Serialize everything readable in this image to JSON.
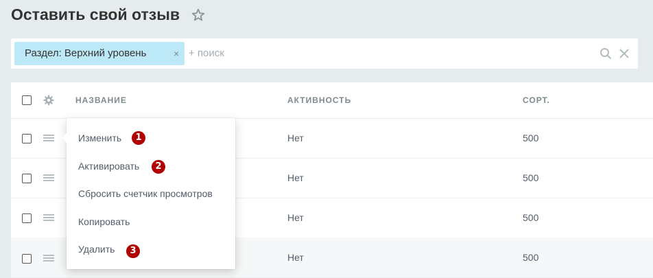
{
  "page": {
    "title": "Оставить свой отзыв"
  },
  "filter": {
    "chip_label": "Раздел: Верхний уровень",
    "chip_close": "×",
    "search_placeholder": "+ поиск"
  },
  "grid": {
    "columns": [
      "НАЗВАНИЕ",
      "АКТИВНОСТЬ",
      "СОРТ."
    ],
    "rows": [
      {
        "active": "Нет",
        "sort": "500"
      },
      {
        "active": "Нет",
        "sort": "500"
      },
      {
        "active": "Нет",
        "sort": "500"
      },
      {
        "active": "Нет",
        "sort": "500"
      }
    ]
  },
  "context_menu": {
    "items": [
      {
        "label": "Изменить",
        "badge": "1"
      },
      {
        "label": "Активировать",
        "badge": "2"
      },
      {
        "label": "Сбросить счетчик просмотров"
      },
      {
        "label": "Копировать"
      },
      {
        "label": "Удалить",
        "badge": "3"
      }
    ]
  },
  "colors": {
    "background": "#e6ecee",
    "chip": "#bde8f7",
    "badge": "#b00000",
    "text": "#535c69"
  }
}
